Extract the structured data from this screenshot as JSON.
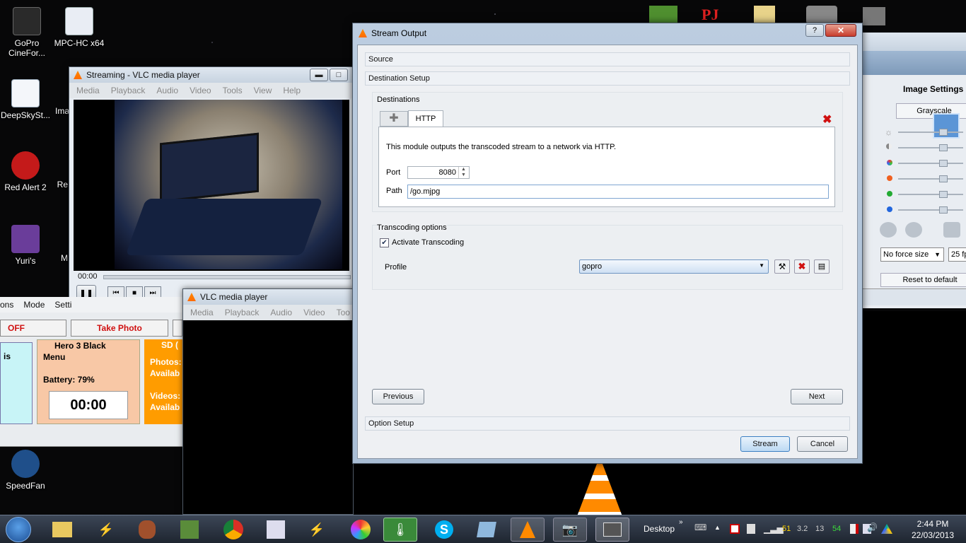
{
  "desktop_icons": [
    {
      "label": "GoPro CineFor..."
    },
    {
      "label": "MPC-HC x64"
    },
    {
      "label": "DeepSkySt..."
    },
    {
      "label": "Ima"
    },
    {
      "label": "Red Alert 2"
    },
    {
      "label": "Re"
    },
    {
      "label": "Yuri's"
    },
    {
      "label": "M"
    },
    {
      "label": "SpeedFan"
    }
  ],
  "streaming_window": {
    "title": "Streaming - VLC media player",
    "menu": [
      "Media",
      "Playback",
      "Audio",
      "Video",
      "Tools",
      "View",
      "Help"
    ],
    "time": "00:00"
  },
  "vlc_window": {
    "title": "VLC media player",
    "menu": [
      "Media",
      "Playback",
      "Audio",
      "Video",
      "Too"
    ]
  },
  "gopro_app": {
    "menu": [
      "ons",
      "Mode",
      "Setti"
    ],
    "off_label": "OFF",
    "photo_label": "Take Photo",
    "left_text": "is",
    "hero_title": "Hero 3 Black",
    "hero_menu": "Menu",
    "battery": "Battery: 79%",
    "timer": "00:00",
    "sd_title": "SD (",
    "photos": "Photos:",
    "avail1": "Availab",
    "videos": "Videos:",
    "avail2": "Availab"
  },
  "image_settings": {
    "title": "Image Settings",
    "grayscale": "Grayscale",
    "force_size": "No force size",
    "fps": "25 fp",
    "reset": "Reset to default"
  },
  "dialog": {
    "title": "Stream Output",
    "help": "?",
    "source": "Source",
    "destination_setup": "Destination Setup",
    "destinations": "Destinations",
    "tab_http": "HTTP",
    "module_text": "This module outputs the transcoded stream to a network via HTTP.",
    "port_label": "Port",
    "port_value": "8080",
    "path_label": "Path",
    "path_value": "/go.mjpg",
    "transcoding_options": "Transcoding options",
    "activate_transcoding": "Activate Transcoding",
    "profile_label": "Profile",
    "profile_value": "gopro",
    "previous": "Previous",
    "next": "Next",
    "option_setup": "Option Setup",
    "stream": "Stream",
    "cancel": "Cancel"
  },
  "taskbar": {
    "desktop": "Desktop",
    "tray_nums": [
      "51",
      "3.2",
      "13",
      "54"
    ],
    "time": "2:44 PM",
    "date": "22/03/2013"
  }
}
